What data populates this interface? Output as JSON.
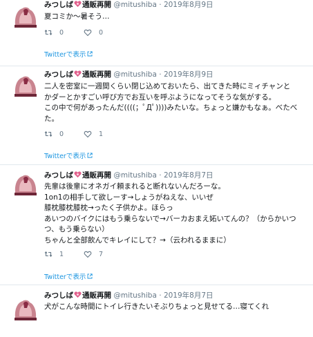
{
  "colors": {
    "link": "#1b95e0",
    "meta": "#657786",
    "separator": "#e1e8ed",
    "avatar_accent": "#b5415d"
  },
  "tweets": [
    {
      "name": "みつしば",
      "badge": "通販再開",
      "handle": "@mitushiba",
      "separator": "·",
      "date": "2019年8月9日",
      "lines": [
        "夏コミか〜暑そう…"
      ],
      "retweets": "0",
      "likes": "0",
      "twitter_link": "Twitterで表示"
    },
    {
      "name": "みつしば",
      "badge": "通販再開",
      "handle": "@mitushiba",
      "separator": "·",
      "date": "2019年8月9日",
      "lines": [
        "二人を密室に一週間くらい閉じ込めておいたら、出てきた時にミィチャンと",
        "かダーとかすごい呼び方でお互いを呼ぶようになってそうな気がする。",
        "この中で何があったんだ((((；ﾟДﾟ))))みたいな。ちょっと嫌かもなぁ。べたべ",
        "た。"
      ],
      "retweets": "0",
      "likes": "1",
      "twitter_link": "Twitterで表示"
    },
    {
      "name": "みつしば",
      "badge": "通販再開",
      "handle": "@mitushiba",
      "separator": "·",
      "date": "2019年8月7日",
      "lines": [
        "先輩は後輩にオネガイ頼まれると断れないんだろーな。",
        "1on1の相手して欲しーす→しょうがねえな、いいぜ",
        "膝枕膝枕膝枕→ったく子供かよ。ほらっ",
        "あいつのバイクにはもう乗らないで→バーカおまえ妬いてんの？（からかいつ",
        "つ、もう乗らない）",
        "ちゃんと全部飲んでキレイにして？→（云われるままに）"
      ],
      "retweets": "1",
      "likes": "7",
      "twitter_link": "Twitterで表示"
    },
    {
      "name": "みつしば",
      "badge": "通販再開",
      "handle": "@mitushiba",
      "separator": "·",
      "date": "2019年8月7日",
      "lines": [
        "犬がこんな時間にトイレ行きたいそぶりちょっと見せてる…寝てくれ"
      ],
      "retweets": "",
      "likes": "",
      "twitter_link": ""
    }
  ]
}
